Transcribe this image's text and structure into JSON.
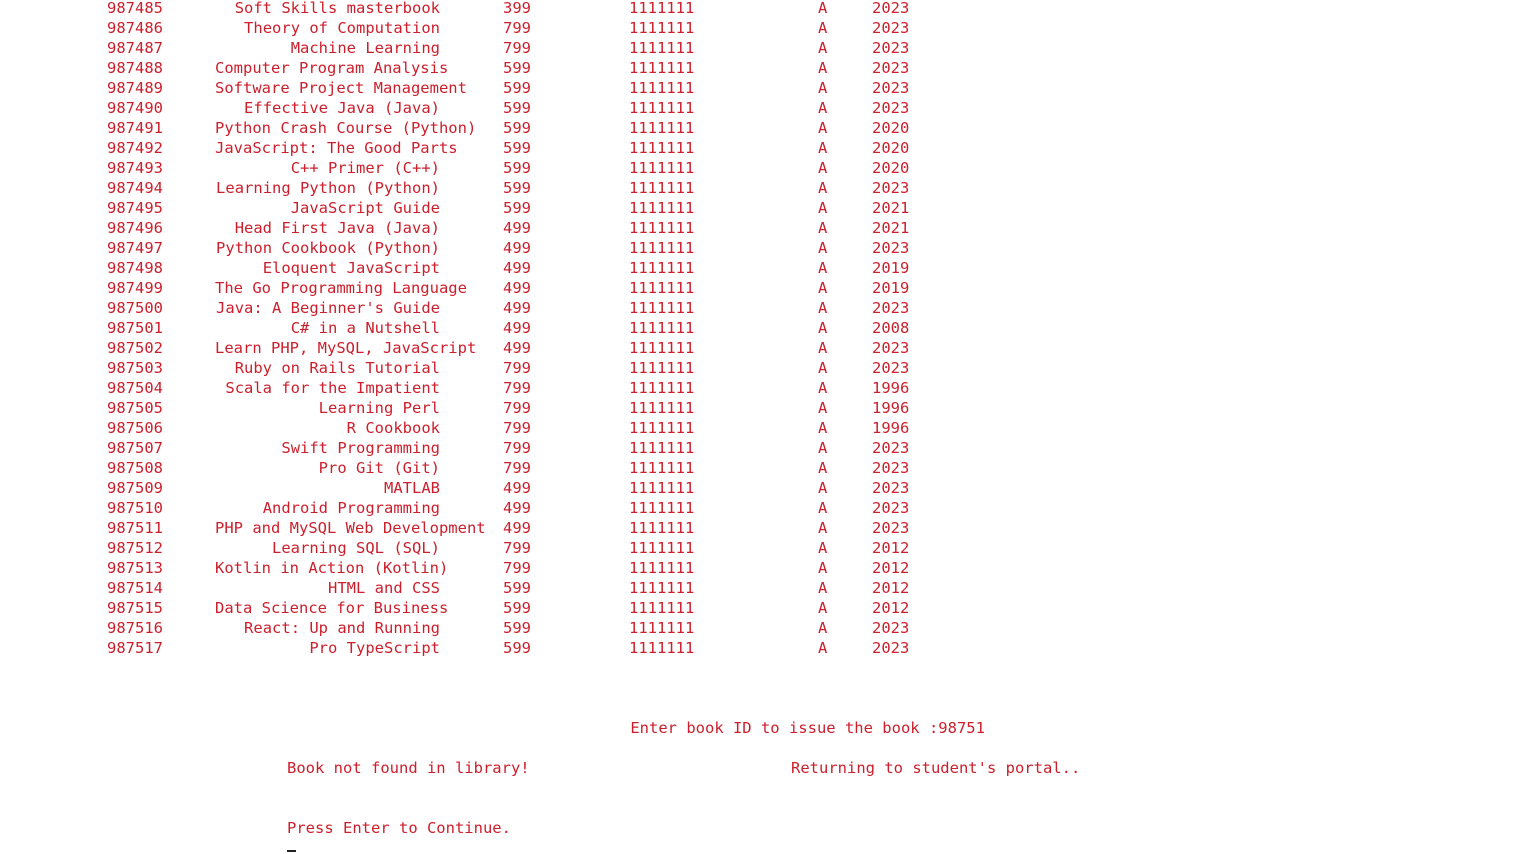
{
  "books": [
    {
      "id": "987485",
      "title": "Soft Skills masterbook",
      "price": "399",
      "copies": "1111111",
      "status": "A",
      "year": "2023"
    },
    {
      "id": "987486",
      "title": "Theory of Computation",
      "price": "799",
      "copies": "1111111",
      "status": "A",
      "year": "2023"
    },
    {
      "id": "987487",
      "title": "Machine Learning",
      "price": "799",
      "copies": "1111111",
      "status": "A",
      "year": "2023"
    },
    {
      "id": "987488",
      "title": "Computer Program Analysis",
      "price": "599",
      "copies": "1111111",
      "status": "A",
      "year": "2023"
    },
    {
      "id": "987489",
      "title": "Software Project Management",
      "price": "599",
      "copies": "1111111",
      "status": "A",
      "year": "2023"
    },
    {
      "id": "987490",
      "title": "Effective Java (Java)",
      "price": "599",
      "copies": "1111111",
      "status": "A",
      "year": "2023"
    },
    {
      "id": "987491",
      "title": "Python Crash Course (Python)",
      "price": "599",
      "copies": "1111111",
      "status": "A",
      "year": "2020"
    },
    {
      "id": "987492",
      "title": "JavaScript: The Good Parts",
      "price": "599",
      "copies": "1111111",
      "status": "A",
      "year": "2020"
    },
    {
      "id": "987493",
      "title": "C++ Primer (C++)",
      "price": "599",
      "copies": "1111111",
      "status": "A",
      "year": "2020"
    },
    {
      "id": "987494",
      "title": "Learning Python (Python)",
      "price": "599",
      "copies": "1111111",
      "status": "A",
      "year": "2023"
    },
    {
      "id": "987495",
      "title": "JavaScript Guide",
      "price": "599",
      "copies": "1111111",
      "status": "A",
      "year": "2021"
    },
    {
      "id": "987496",
      "title": "Head First Java (Java)",
      "price": "499",
      "copies": "1111111",
      "status": "A",
      "year": "2021"
    },
    {
      "id": "987497",
      "title": "Python Cookbook (Python)",
      "price": "499",
      "copies": "1111111",
      "status": "A",
      "year": "2023"
    },
    {
      "id": "987498",
      "title": "Eloquent JavaScript",
      "price": "499",
      "copies": "1111111",
      "status": "A",
      "year": "2019"
    },
    {
      "id": "987499",
      "title": "The Go Programming Language",
      "price": "499",
      "copies": "1111111",
      "status": "A",
      "year": "2019"
    },
    {
      "id": "987500",
      "title": "Java: A Beginner's Guide",
      "price": "499",
      "copies": "1111111",
      "status": "A",
      "year": "2023"
    },
    {
      "id": "987501",
      "title": "C# in a Nutshell",
      "price": "499",
      "copies": "1111111",
      "status": "A",
      "year": "2008"
    },
    {
      "id": "987502",
      "title": "Learn PHP, MySQL, JavaScript",
      "price": "499",
      "copies": "1111111",
      "status": "A",
      "year": "2023"
    },
    {
      "id": "987503",
      "title": "Ruby on Rails Tutorial",
      "price": "799",
      "copies": "1111111",
      "status": "A",
      "year": "2023"
    },
    {
      "id": "987504",
      "title": "Scala for the Impatient",
      "price": "799",
      "copies": "1111111",
      "status": "A",
      "year": "1996"
    },
    {
      "id": "987505",
      "title": "Learning Perl",
      "price": "799",
      "copies": "1111111",
      "status": "A",
      "year": "1996"
    },
    {
      "id": "987506",
      "title": "R Cookbook",
      "price": "799",
      "copies": "1111111",
      "status": "A",
      "year": "1996"
    },
    {
      "id": "987507",
      "title": "Swift Programming",
      "price": "799",
      "copies": "1111111",
      "status": "A",
      "year": "2023"
    },
    {
      "id": "987508",
      "title": "Pro Git (Git)",
      "price": "799",
      "copies": "1111111",
      "status": "A",
      "year": "2023"
    },
    {
      "id": "987509",
      "title": "MATLAB",
      "price": "499",
      "copies": "1111111",
      "status": "A",
      "year": "2023"
    },
    {
      "id": "987510",
      "title": "Android Programming",
      "price": "499",
      "copies": "1111111",
      "status": "A",
      "year": "2023"
    },
    {
      "id": "987511",
      "title": "PHP and MySQL Web Development",
      "price": "499",
      "copies": "1111111",
      "status": "A",
      "year": "2023"
    },
    {
      "id": "987512",
      "title": "Learning SQL (SQL)",
      "price": "799",
      "copies": "1111111",
      "status": "A",
      "year": "2012"
    },
    {
      "id": "987513",
      "title": "Kotlin in Action (Kotlin)",
      "price": "799",
      "copies": "1111111",
      "status": "A",
      "year": "2012"
    },
    {
      "id": "987514",
      "title": "HTML and CSS",
      "price": "599",
      "copies": "1111111",
      "status": "A",
      "year": "2012"
    },
    {
      "id": "987515",
      "title": "Data Science for Business",
      "price": "599",
      "copies": "1111111",
      "status": "A",
      "year": "2012"
    },
    {
      "id": "987516",
      "title": "React: Up and Running",
      "price": "599",
      "copies": "1111111",
      "status": "A",
      "year": "2023"
    },
    {
      "id": "987517",
      "title": "Pro TypeScript",
      "price": "599",
      "copies": "1111111",
      "status": "A",
      "year": "2023"
    }
  ],
  "prompt": {
    "label": "Enter book ID to issue the book :",
    "value": "98751"
  },
  "messages": {
    "not_found": "Book not found in library!",
    "returning": "Returning to student's portal..",
    "continue": "Press Enter to Continue."
  },
  "colors": {
    "text": "#cc1f2c",
    "background": "#ffffff"
  }
}
